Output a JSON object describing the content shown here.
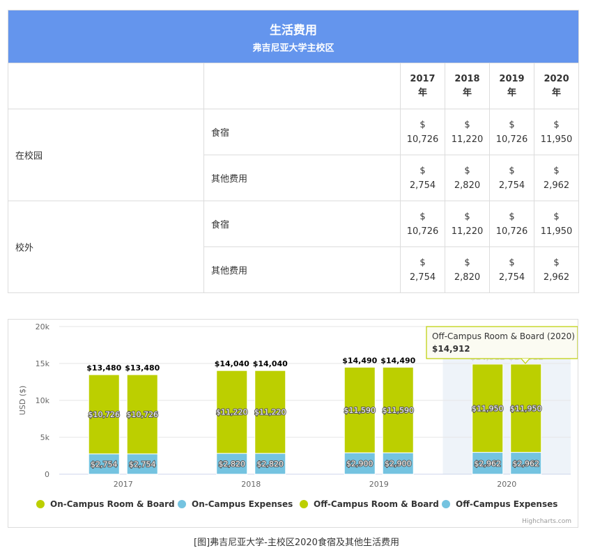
{
  "table": {
    "title": "生活费用",
    "subtitle": "弗吉尼亚大学主校区",
    "years": [
      {
        "y": "2017",
        "s": "年"
      },
      {
        "y": "2018",
        "s": "年"
      },
      {
        "y": "2019",
        "s": "年"
      },
      {
        "y": "2020",
        "s": "年"
      }
    ],
    "groups": [
      {
        "name": "在校园",
        "rows": [
          {
            "label": "食宿",
            "values": [
              {
                "cur": "$",
                "amt": "10,726"
              },
              {
                "cur": "$",
                "amt": "11,220"
              },
              {
                "cur": "$",
                "amt": "10,726"
              },
              {
                "cur": "$",
                "amt": "11,950"
              }
            ]
          },
          {
            "label": "其他费用",
            "values": [
              {
                "cur": "$",
                "amt": "2,754"
              },
              {
                "cur": "$",
                "amt": "2,820"
              },
              {
                "cur": "$",
                "amt": "2,754"
              },
              {
                "cur": "$",
                "amt": "2,962"
              }
            ]
          }
        ]
      },
      {
        "name": "校外",
        "rows": [
          {
            "label": "食宿",
            "values": [
              {
                "cur": "$",
                "amt": "10,726"
              },
              {
                "cur": "$",
                "amt": "11,220"
              },
              {
                "cur": "$",
                "amt": "10,726"
              },
              {
                "cur": "$",
                "amt": "11,950"
              }
            ]
          },
          {
            "label": "其他费用",
            "values": [
              {
                "cur": "$",
                "amt": "2,754"
              },
              {
                "cur": "$",
                "amt": "2,820"
              },
              {
                "cur": "$",
                "amt": "2,754"
              },
              {
                "cur": "$",
                "amt": "2,962"
              }
            ]
          }
        ]
      }
    ]
  },
  "chart_data": {
    "type": "bar",
    "stacked": true,
    "categories": [
      "2017",
      "2018",
      "2019",
      "2020"
    ],
    "ylabel": "USD ($)",
    "ylim": [
      0,
      20000
    ],
    "yticks": [
      "0",
      "5k",
      "10k",
      "15k",
      "20k"
    ],
    "series": [
      {
        "name": "On-Campus Room & Board",
        "stack": "on",
        "color": "#bccf00",
        "values": [
          10726,
          11220,
          11590,
          11950
        ],
        "labels": [
          "$10,726",
          "$11,220",
          "$11,590",
          "$11,950"
        ]
      },
      {
        "name": "On-Campus Expenses",
        "stack": "on",
        "color": "#74c3e0",
        "values": [
          2754,
          2820,
          2900,
          2962
        ],
        "labels": [
          "$2,754",
          "$2,820",
          "$2,900",
          "$2,962"
        ]
      },
      {
        "name": "Off-Campus Room & Board",
        "stack": "off",
        "color": "#bccf00",
        "values": [
          10726,
          11220,
          11590,
          11950
        ],
        "labels": [
          "$10,726",
          "$11,220",
          "$11,590",
          "$11,950"
        ]
      },
      {
        "name": "Off-Campus Expenses",
        "stack": "off",
        "color": "#74c3e0",
        "values": [
          2754,
          2820,
          2900,
          2962
        ],
        "labels": [
          "$2,754",
          "$2,820",
          "$2,900",
          "$2,962"
        ]
      }
    ],
    "totals": [
      {
        "on": "$13,480",
        "off": "$13,480"
      },
      {
        "on": "$14,040",
        "off": "$14,040"
      },
      {
        "on": "$14,490",
        "off": "$14,490"
      },
      {
        "on": "$14,912",
        "off": "$14,912"
      }
    ],
    "grid": true,
    "legend": "bottom",
    "highlighted_category": "2020",
    "tooltip": {
      "title": "Off-Campus Room & Board (2020)",
      "value": "$14,912"
    },
    "credits": "Highcharts.com"
  },
  "caption": "[图]弗吉尼亚大学-主校区2020食宿及其他生活费用"
}
